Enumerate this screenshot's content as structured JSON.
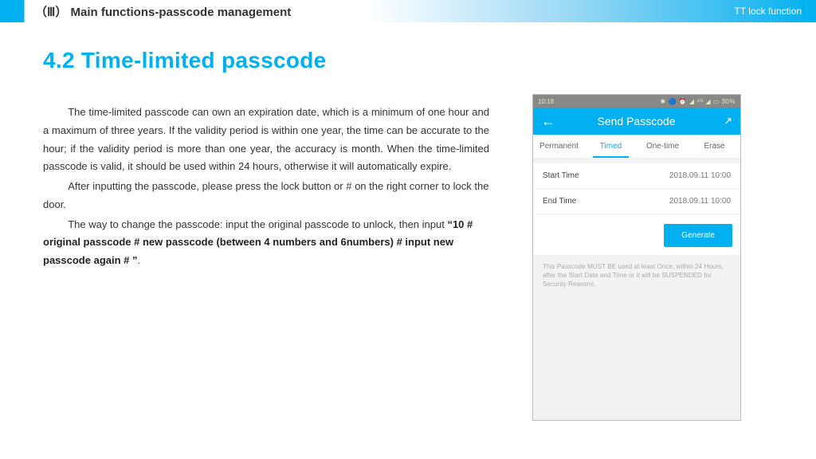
{
  "header": {
    "section": "（Ⅲ）  Main functions-passcode management",
    "right": "TT lock function"
  },
  "content": {
    "title": "4.2 Time-limited passcode",
    "p1": "The time-limited passcode can own an expiration date, which is a minimum of one hour and a maximum of three years. If the validity period is within one year, the time can be accurate to the hour; if the validity period is more than one year, the accuracy is month. When the time-limited passcode is valid, it should be used within 24 hours, otherwise it will automatically expire.",
    "p2": "After inputting the passcode, please press the lock button or # on the right corner to lock the door.",
    "p3a": "The way to change the passcode: input the original passcode to unlock, then input ",
    "p3b": "“10 # original passcode # new passcode (between 4 numbers and 6numbers) # input new passcode again # ”",
    "p3c": "."
  },
  "phone": {
    "status_time": "10:18",
    "status_right": "✱ 🔵 ⏰ ◢ ⁴ᴳ ◢ ▭ 30%",
    "app_title": "Send Passcode",
    "tabs": {
      "t1": "Permanent",
      "t2": "Timed",
      "t3": "One-time",
      "t4": "Erase"
    },
    "row1": {
      "label": "Start Time",
      "value": "2018.09.11 10:00"
    },
    "row2": {
      "label": "End Time",
      "value": "2018.09.11 10:00"
    },
    "generate": "Generate",
    "note": "This Passcode MUST BE used at least Once, within 24 Hours, after the Start Date and Time or it will be SUSPENDED for Security Reasons."
  }
}
